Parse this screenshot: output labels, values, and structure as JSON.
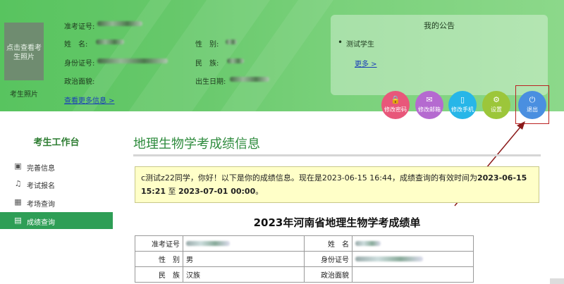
{
  "profile": {
    "photo_placeholder": "点击查看考生照片",
    "photo_caption": "考生照片",
    "labels": {
      "ticket": "准考证号:",
      "name": "姓　名:",
      "id": "身份证号:",
      "politics": "政治面貌:",
      "gender": "性　别:",
      "ethnicity": "民　族:",
      "birth": "出生日期:"
    },
    "more_info": "查看更多信息 >"
  },
  "notice": {
    "title": "我的公告",
    "items": [
      "测试学生"
    ],
    "more": "更多 >"
  },
  "actions": [
    {
      "label": "修改密码",
      "icon": "lock-icon",
      "glyph": "🔒",
      "color": "#e8577a"
    },
    {
      "label": "修改邮箱",
      "icon": "mail-icon",
      "glyph": "✉",
      "color": "#b56ad0"
    },
    {
      "label": "修改手机",
      "icon": "phone-icon",
      "glyph": "▯",
      "color": "#27b6e8"
    },
    {
      "label": "设置",
      "icon": "gear-icon",
      "glyph": "⚙",
      "color": "#9cc63a"
    },
    {
      "label": "退出",
      "icon": "power-icon",
      "glyph": "⏻",
      "color": "#4a8fe0"
    }
  ],
  "sidebar": {
    "title": "考生工作台",
    "items": [
      {
        "label": "完善信息",
        "icon": "id-card-icon",
        "glyph": "▣"
      },
      {
        "label": "考试报名",
        "icon": "bell-icon",
        "glyph": "♫"
      },
      {
        "label": "考场查询",
        "icon": "grid-icon",
        "glyph": "▦"
      },
      {
        "label": "成绩查询",
        "icon": "score-icon",
        "glyph": "▤",
        "active": true
      }
    ]
  },
  "main": {
    "title": "地理生物学考成绩信息",
    "message_prefix": "c测试z22同学，你好！以下是你的成绩信息。现在是2023-06-15 16:44，成绩查询的有效时间为",
    "message_start": "2023-06-15 15:21",
    "message_mid": " 至 ",
    "message_end": "2023-07-01 00:00",
    "message_suffix": "。",
    "report_title": "2023年河南省地理生物学考成绩单",
    "table": {
      "rows": [
        {
          "l1": "准考证号",
          "v1": "",
          "l2": "姓　名",
          "v2": ""
        },
        {
          "l1": "性　别",
          "v1": "男",
          "l2": "身份证号",
          "v2": ""
        },
        {
          "l1": "民　族",
          "v1": "汉族",
          "l2": "政治面貌",
          "v2": ""
        }
      ]
    }
  }
}
